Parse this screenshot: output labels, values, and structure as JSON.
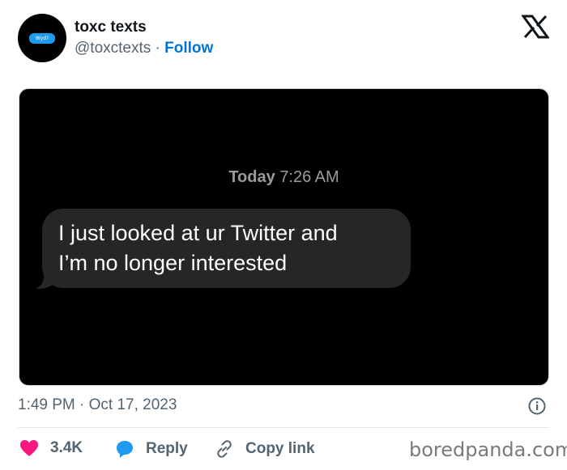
{
  "profile": {
    "avatar_text": "Wyd?",
    "display_name": "toxc texts",
    "handle": "@toxctexts",
    "separator": "·",
    "follow_label": "Follow"
  },
  "brand_icon": "x-logo-icon",
  "media": {
    "timestamp_day": "Today",
    "timestamp_time": "7:26 AM",
    "message_lines": [
      "I just looked at ur Twitter and",
      "I’m no longer interested"
    ]
  },
  "tweet": {
    "time": "1:49 PM · Oct 17, 2023",
    "info_icon": "info-icon"
  },
  "actions": {
    "like_count": "3.4K",
    "reply_label": "Reply",
    "copy_label": "Copy link"
  },
  "watermark": "boredpanda.com",
  "colors": {
    "like": "#f91880",
    "reply": "#1d9bf0",
    "follow": "#0074d4",
    "muted": "#536471"
  }
}
